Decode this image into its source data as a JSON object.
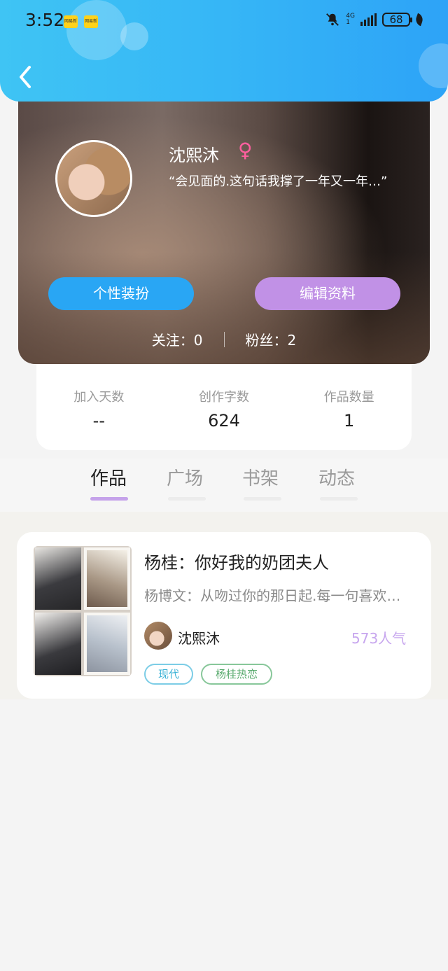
{
  "status_bar": {
    "time": "3:52",
    "badge1": "网易新",
    "badge2": "网易新",
    "network": "4G",
    "network_sub": "1",
    "battery": "68",
    "icons": [
      "bell-muted-icon",
      "signal-icon",
      "battery-icon",
      "leaf-icon"
    ]
  },
  "header": {
    "back_icon": "chevron-left-icon",
    "accent_color": "#36b6f6"
  },
  "profile": {
    "name": "沈熙沐",
    "gender_symbol": "♀",
    "bio": "“会见面的.这句话我撑了一年又一年…”",
    "decorate_button": "个性装扮",
    "edit_button": "编辑资料",
    "following_label": "关注：",
    "following_count": "0",
    "followers_label": "粉丝：",
    "followers_count": "2"
  },
  "stats": [
    {
      "label": "加入天数",
      "value": "--"
    },
    {
      "label": "创作字数",
      "value": "624"
    },
    {
      "label": "作品数量",
      "value": "1"
    }
  ],
  "tabs": [
    "作品",
    "广场",
    "书架",
    "动态"
  ],
  "active_tab": "作品",
  "works": [
    {
      "title": "杨桂：你好我的奶团夫人",
      "description": "杨博文：从吻过你的那日起.每一句喜欢…",
      "author": "沈熙沐",
      "popularity": "573人气",
      "tags": [
        "现代",
        "杨桂热恋"
      ]
    }
  ]
}
